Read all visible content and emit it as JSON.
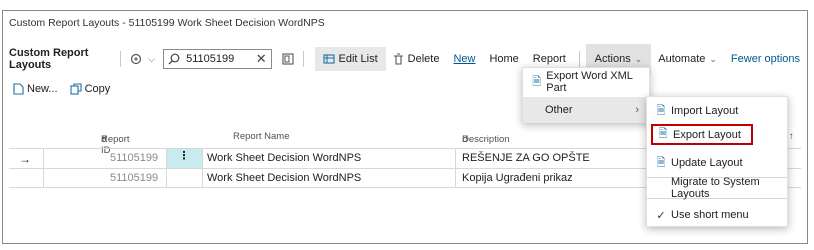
{
  "window": {
    "title": "Custom Report Layouts - 51105199 Work Sheet Decision WordNPS"
  },
  "actionbar": {
    "page_name": "Custom Report Layouts",
    "search_value": "51105199",
    "buttons": {
      "edit_list": "Edit List",
      "delete": "Delete",
      "new": "New",
      "home": "Home",
      "report": "Report",
      "actions": "Actions",
      "automate": "Automate",
      "fewer_options": "Fewer options"
    }
  },
  "subbar": {
    "new": "New...",
    "copy": "Copy"
  },
  "grid": {
    "columns": {
      "report_id": "Report ID",
      "report_name": "Report Name",
      "description": "Description"
    },
    "rows": [
      {
        "report_id": "51105199",
        "report_name": "Work Sheet Decision WordNPS",
        "description": "REŠENJE ZA GO OPŠTE"
      },
      {
        "report_id": "51105199",
        "report_name": "Work Sheet Decision WordNPS",
        "description": "Kopija Ugrađeni prikaz"
      }
    ]
  },
  "actions_menu": {
    "export_word_xml": "Export Word XML Part",
    "other": "Other"
  },
  "other_submenu": {
    "import_layout": "Import Layout",
    "export_layout": "Export Layout",
    "update_layout": "Update Layout",
    "migrate": "Migrate to System Layouts",
    "short_menu": "Use short menu"
  },
  "colors": {
    "accent": "#00598e",
    "highlight": "#c00000",
    "selected_cell": "#c8ebf0"
  }
}
